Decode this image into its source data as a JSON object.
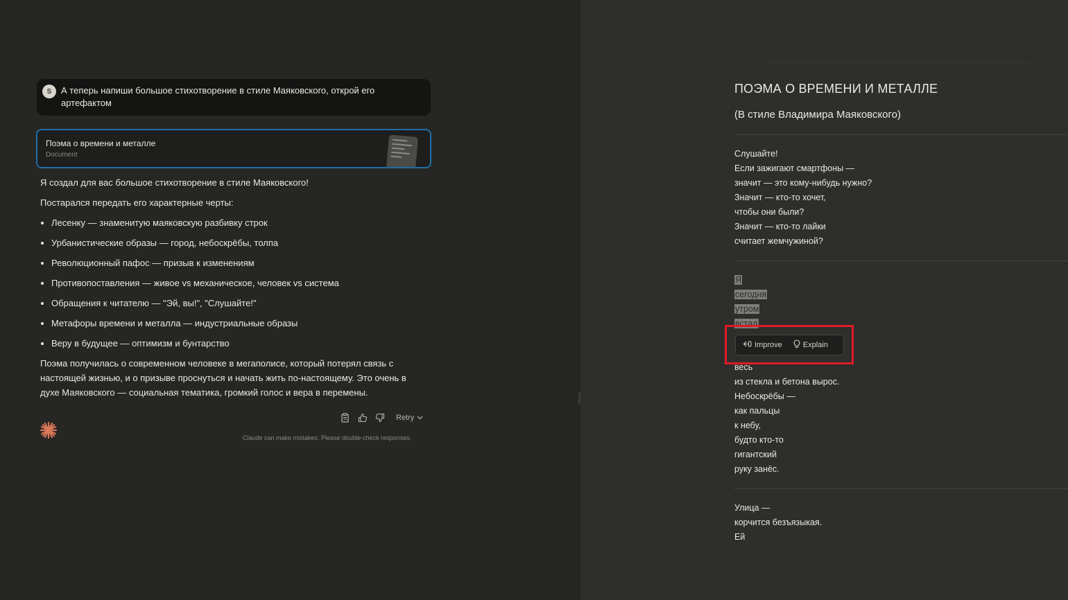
{
  "user_message": {
    "avatar_initial": "S",
    "text": "А теперь напиши большое стихотворение в стиле Маяковского, открой его артефактом"
  },
  "artifact_card": {
    "title": "Поэма о времени и металле",
    "type": "Document"
  },
  "assistant": {
    "intro": "Я создал для вас большое стихотворение в стиле Маяковского!",
    "lead": "Постарался передать его характерные черты:",
    "bullets": [
      "Лесенку — знаменитую маяковскую разбивку строк",
      "Урбанистические образы — город, небоскрёбы, толпа",
      "Революционный пафос — призыв к изменениям",
      "Противопоставления — живое vs механическое, человек vs система",
      "Обращения к читателю — \"Эй, вы!\", \"Слушайте!\"",
      "Метафоры времени и металла — индустриальные образы",
      "Веру в будущее — оптимизм и бунтарство"
    ],
    "conclusion": "Поэма получилась о современном человеке в мегаполисе, который потерял связь с настоящей жизнью, и о призыве проснуться и начать жить по-настоящему. Это очень в духе Маяковского — социальная тематика, громкий голос и вера в перемены."
  },
  "actions": {
    "copy_icon": "clipboard-icon",
    "like_icon": "thumbs-up-icon",
    "dislike_icon": "thumbs-down-icon",
    "retry_label": "Retry"
  },
  "disclaimer": "Claude can make mistakes. Please double-check responses.",
  "document": {
    "title": "ПОЭМА О ВРЕМЕНИ И МЕТАЛЛЕ",
    "subtitle": "(В стиле Владимира Маяковского)",
    "stanza1": [
      "Слушайте!",
      "Если зажигают смартфоны —",
      "значит — это кому-нибудь нужно?",
      "Значит — кто-то хочет,",
      "чтобы они были?",
      "Значит — кто-то лайки",
      "считает жемчужиной?"
    ],
    "stanza2_selected": [
      "Я",
      "сегодня",
      "утром",
      "встал"
    ],
    "stanza2": [
      "весь",
      "из стекла и бетона вырос.",
      "Небоскрёбы —",
      "как пальцы",
      "к небу,",
      "будто кто-то",
      "гигантский",
      "руку занёс."
    ],
    "stanza3": [
      "Улица —",
      "корчится безъязыкая.",
      "Ей"
    ]
  },
  "selection_popup": {
    "improve_label": "Improve",
    "explain_label": "Explain",
    "highlight_color": "#e01b24"
  },
  "colors": {
    "accent_border": "#1f6fa7",
    "claude_logo": "#d97757"
  }
}
